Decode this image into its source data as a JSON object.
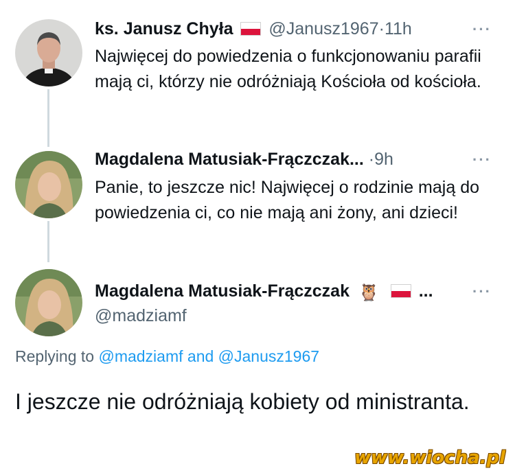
{
  "tweets": [
    {
      "name": "ks. Janusz Chyła",
      "handle": "@Janusz1967",
      "separator": "·",
      "time": "11h",
      "more": "···",
      "text": "Najwięcej do powiedzenia o funkcjonowaniu parafii mają ci, którzy nie odróżniają Kościoła od kościoła."
    },
    {
      "name": "Magdalena Matusiak-Frączczak...",
      "separator": "·",
      "time": "9h",
      "more": "···",
      "text": "Panie, to jeszcze nic! Najwięcej o rodzinie mają do powiedzenia ci, co nie mają ani żony, ani dzieci!"
    },
    {
      "name": "Magdalena Matusiak-Frączczak",
      "owl": "🦉",
      "ellipsis": "...",
      "handle": "@madziamf",
      "more": "···"
    }
  ],
  "replying": {
    "prefix": "Replying to",
    "mention1": "@madziamf",
    "conj": "and",
    "mention2": "@Janusz1967"
  },
  "main_text": "I jeszcze nie odróżniają kobiety od ministranta.",
  "watermark": "www.wiocha.pl",
  "colors": {
    "mention": "#1d9bf0",
    "secondary": "#536471",
    "flag_red": "#dc143c"
  }
}
